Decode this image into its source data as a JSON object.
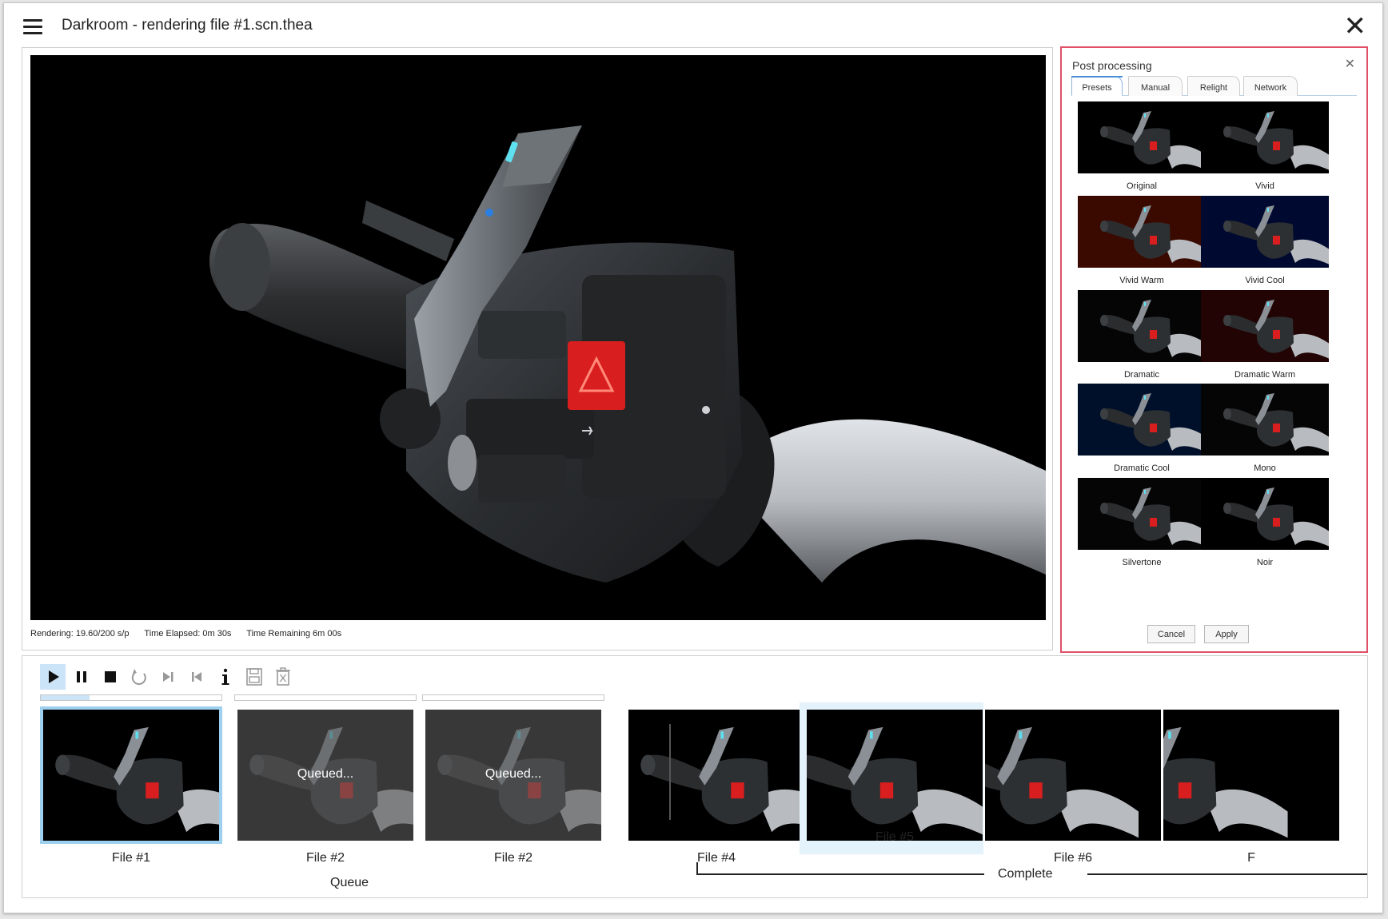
{
  "window": {
    "title": "Darkroom - rendering file #1.scn.thea"
  },
  "status": {
    "rendering": "Rendering: 19.60/200 s/p",
    "elapsed": "Time Elapsed: 0m 30s",
    "remaining": "Time Remaining 6m 00s"
  },
  "post_processing": {
    "title": "Post processing",
    "tabs": [
      "Presets",
      "Manual",
      "Relight",
      "Network"
    ],
    "active_tab": "Presets",
    "presets": [
      {
        "label": "Original",
        "tint": "#000000"
      },
      {
        "label": "Vivid",
        "tint": "#000000"
      },
      {
        "label": "Vivid Warm",
        "tint": "#3a0a00"
      },
      {
        "label": "Vivid Cool",
        "tint": "#000a30"
      },
      {
        "label": "Dramatic",
        "tint": "#050505"
      },
      {
        "label": "Dramatic Warm",
        "tint": "#220404"
      },
      {
        "label": "Dramatic Cool",
        "tint": "#00102a"
      },
      {
        "label": "Mono",
        "tint": "#050505"
      },
      {
        "label": "Silvertone",
        "tint": "#050505"
      },
      {
        "label": "Noir",
        "tint": "#000000"
      }
    ],
    "cancel_label": "Cancel",
    "apply_label": "Apply"
  },
  "toolbar": {
    "icons": [
      "play-icon",
      "pause-icon",
      "stop-icon",
      "restart-icon",
      "skip-next-icon",
      "skip-previous-icon",
      "info-icon",
      "save-icon",
      "delete-icon"
    ]
  },
  "jobs": [
    {
      "label": "File #1",
      "state": "rendering",
      "progress": 0.27
    },
    {
      "label": "File #2",
      "state": "queued",
      "overlay": "Queued...",
      "progress": 0
    },
    {
      "label": "File #2",
      "state": "queued",
      "overlay": "Queued...",
      "progress": 0
    },
    {
      "label": "File #4",
      "state": "complete"
    },
    {
      "label": "File #5",
      "state": "complete",
      "selected": true
    },
    {
      "label": "File #6",
      "state": "complete"
    },
    {
      "label": "F",
      "state": "complete"
    }
  ],
  "groups": {
    "queue_label": "Queue",
    "complete_label": "Complete"
  },
  "colors": {
    "accent": "#4a8ed8",
    "selection": "#9dd0ee",
    "panel_highlight": "#e05068",
    "hazard": "#d81e1e"
  }
}
